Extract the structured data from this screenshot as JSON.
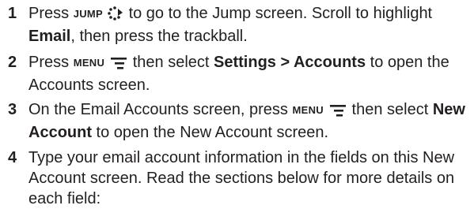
{
  "steps": [
    {
      "number": "1",
      "line1": {
        "a": "Press ",
        "key": "JUMP",
        "b": " to go to the Jump screen. Scroll to highlight"
      },
      "line2": {
        "bold": "Email",
        "rest": ", then press the trackball."
      }
    },
    {
      "number": "2",
      "line1": {
        "a": "Press ",
        "key": "MENU",
        "b": " then select ",
        "bold": "Settings > Accounts",
        "c": " to open the"
      },
      "line2": "Accounts screen."
    },
    {
      "number": "3",
      "line1": {
        "a": "On the Email Accounts screen, press ",
        "key": "MENU",
        "b": " then select ",
        "bold": "New"
      },
      "line2": {
        "bold": "Account",
        "rest": " to open the New Account screen."
      }
    },
    {
      "number": "4",
      "line1": "Type your email account information in the fields on this New",
      "line2": "Account screen. Read the sections below for more details on",
      "line3": "each field:"
    }
  ],
  "icons": {
    "jump": "jump-key-icon",
    "menu": "menu-key-icon"
  },
  "colors": {
    "text": "#231f20"
  }
}
